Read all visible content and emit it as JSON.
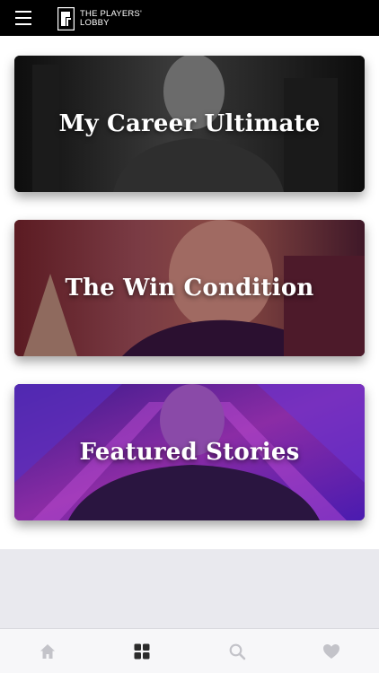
{
  "header": {
    "menu_icon": "hamburger-icon",
    "logo": {
      "line1": "THE PLAYERS'",
      "line2": "LOBBY"
    }
  },
  "cards": [
    {
      "title": "My Career Ultimate"
    },
    {
      "title": "The Win Condition"
    },
    {
      "title": "Featured Stories"
    }
  ],
  "tabbar": {
    "tabs": [
      {
        "icon": "home-icon",
        "active": false
      },
      {
        "icon": "grid-icon",
        "active": true
      },
      {
        "icon": "search-icon",
        "active": false
      },
      {
        "icon": "heart-icon",
        "active": false
      }
    ],
    "colors": {
      "active": "#2b2b2b",
      "inactive": "#c3c3c9"
    }
  }
}
